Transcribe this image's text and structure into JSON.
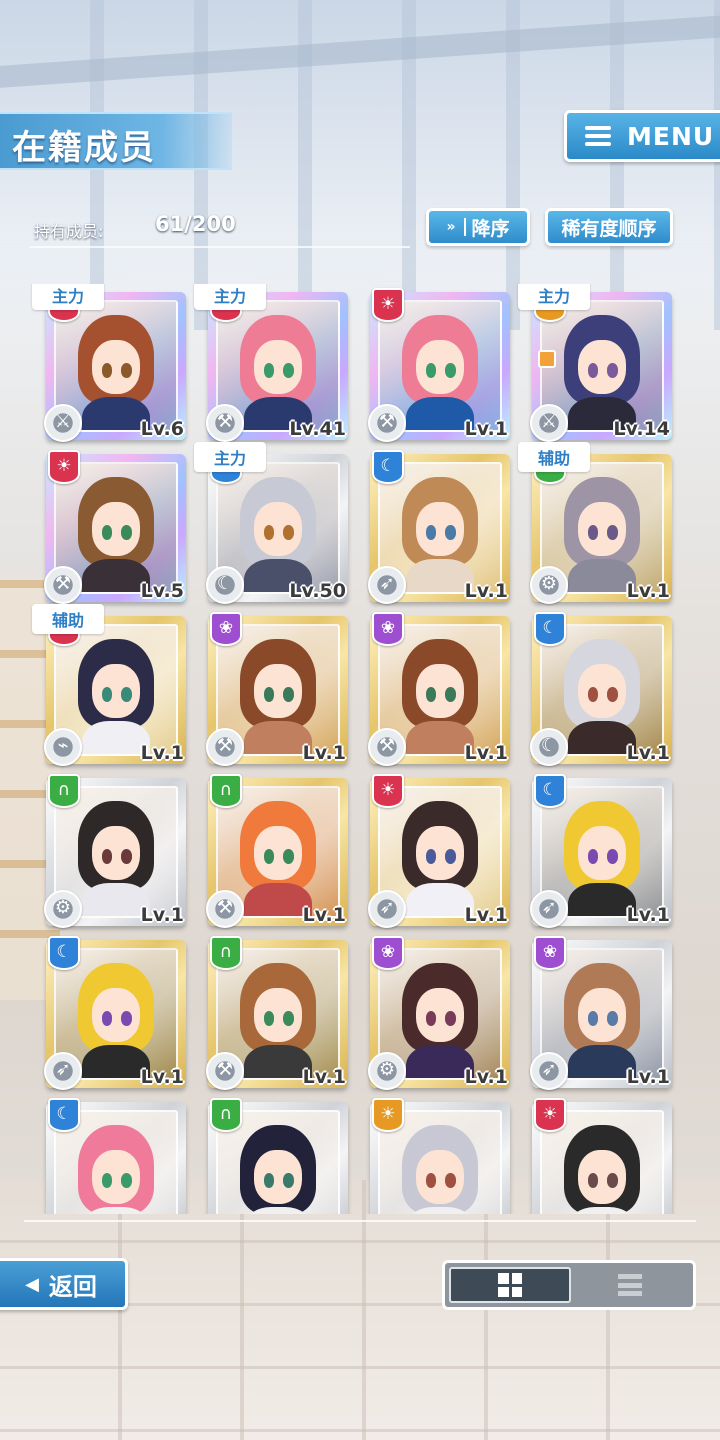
{
  "header": {
    "title": "在籍成员",
    "menu_label": "MENU"
  },
  "member_count": {
    "label": "持有成员:",
    "value": "61/200"
  },
  "sort": {
    "order_label": "降序",
    "order_icon": "chevron-double-down-icon",
    "rarity_label": "稀有度顺序"
  },
  "cards": [
    {
      "frame": "rainbow",
      "attribute": "red",
      "role": "主力",
      "level": "Lv.6",
      "type_icon": "sword-icon",
      "hair": "#a5502e",
      "outfit": "#2b3a6e",
      "eyes": "#8a5a2a"
    },
    {
      "frame": "rainbow",
      "attribute": "red",
      "role": "主力",
      "level": "Lv.41",
      "type_icon": "hammer-icon",
      "hair": "#ef7c95",
      "outfit": "#2b3a6e",
      "eyes": "#3a9a6a"
    },
    {
      "frame": "rainbow",
      "attribute": "red",
      "role": "",
      "level": "Lv.1",
      "type_icon": "hammer-icon",
      "hair": "#ef7c95",
      "outfit": "#1e5aa8",
      "eyes": "#3a9a6a"
    },
    {
      "frame": "rainbow",
      "attribute": "orange",
      "role": "主力",
      "level": "Lv.14",
      "type_icon": "sword-icon",
      "hair": "#3c3f7a",
      "outfit": "#2a2a3a",
      "eyes": "#7a5a9a",
      "locked": true
    },
    {
      "frame": "rainbow",
      "attribute": "red",
      "role": "",
      "level": "Lv.5",
      "type_icon": "hammer-icon",
      "hair": "#8a5a33",
      "outfit": "#3a3038",
      "eyes": "#3a8a5a"
    },
    {
      "frame": "silver",
      "attribute": "blue",
      "role": "主力",
      "level": "Lv.50",
      "type_icon": "scythe-icon",
      "hair": "#c7c9d4",
      "outfit": "#4a4f6a",
      "eyes": "#b07030"
    },
    {
      "frame": "gold",
      "attribute": "blue",
      "role": "",
      "level": "Lv.1",
      "type_icon": "spear-icon",
      "hair": "#c08a56",
      "outfit": "#e8d8c8",
      "eyes": "#4a7aa8"
    },
    {
      "frame": "gold",
      "attribute": "green",
      "role": "辅助",
      "level": "Lv.1",
      "type_icon": "shield-icon",
      "hair": "#9d94a6",
      "outfit": "#8a8a9a",
      "eyes": "#6a5a8a"
    },
    {
      "frame": "gold",
      "attribute": "red",
      "role": "辅助",
      "level": "Lv.1",
      "type_icon": "gun-icon",
      "hair": "#2c2c48",
      "outfit": "#f0f0f4",
      "eyes": "#3a8a7a"
    },
    {
      "frame": "gold",
      "attribute": "purple",
      "role": "",
      "level": "Lv.1",
      "type_icon": "hammer-icon",
      "hair": "#8a4a2a",
      "outfit": "#c08060",
      "eyes": "#3a7a5a"
    },
    {
      "frame": "gold",
      "attribute": "purple",
      "role": "",
      "level": "Lv.1",
      "type_icon": "hammer-icon",
      "hair": "#8a4a2a",
      "outfit": "#c08060",
      "eyes": "#3a7a5a"
    },
    {
      "frame": "gold",
      "attribute": "blue",
      "role": "",
      "level": "Lv.1",
      "type_icon": "scythe-icon",
      "hair": "#d6d6de",
      "outfit": "#3a2a2a",
      "eyes": "#a05040"
    },
    {
      "frame": "silver",
      "attribute": "green",
      "role": "",
      "level": "Lv.1",
      "type_icon": "shield-icon",
      "hair": "#2e2828",
      "outfit": "#e8e8ee",
      "eyes": "#6a3a3a"
    },
    {
      "frame": "gold",
      "attribute": "green",
      "role": "",
      "level": "Lv.1",
      "type_icon": "hammer-icon",
      "hair": "#f07a3c",
      "outfit": "#c04a4a",
      "eyes": "#3a8a5a"
    },
    {
      "frame": "gold",
      "attribute": "red",
      "role": "",
      "level": "Lv.1",
      "type_icon": "spear-icon",
      "hair": "#3a2a2a",
      "outfit": "#f0f0f6",
      "eyes": "#4a5a9a"
    },
    {
      "frame": "silver",
      "attribute": "blue",
      "role": "",
      "level": "Lv.1",
      "type_icon": "spear-icon",
      "hair": "#f0c832",
      "outfit": "#2a2a2a",
      "eyes": "#7a4ab0"
    },
    {
      "frame": "gold",
      "attribute": "blue",
      "role": "",
      "level": "Lv.1",
      "type_icon": "spear-icon",
      "hair": "#f0c832",
      "outfit": "#2a2a2a",
      "eyes": "#7a4ab0"
    },
    {
      "frame": "gold",
      "attribute": "green",
      "role": "",
      "level": "Lv.1",
      "type_icon": "hammer-icon",
      "hair": "#a8683a",
      "outfit": "#3a3a3a",
      "eyes": "#3a8a5a"
    },
    {
      "frame": "gold",
      "attribute": "purple",
      "role": "",
      "level": "Lv.1",
      "type_icon": "shield-icon",
      "hair": "#4a2a2a",
      "outfit": "#3a2a5a",
      "eyes": "#7a3a5a"
    },
    {
      "frame": "silver",
      "attribute": "purple",
      "role": "",
      "level": "Lv.1",
      "type_icon": "spear-icon",
      "hair": "#b07a56",
      "outfit": "#2a3a5a",
      "eyes": "#5a7aa8"
    },
    {
      "frame": "silver",
      "attribute": "blue",
      "role": "",
      "level": "",
      "type_icon": "",
      "hair": "#f07a9a",
      "outfit": "#f0f0f0",
      "eyes": "#3a9a6a"
    },
    {
      "frame": "silver",
      "attribute": "green",
      "role": "",
      "level": "",
      "type_icon": "",
      "hair": "#22223a",
      "outfit": "#f0f0f0",
      "eyes": "#3a7a6a"
    },
    {
      "frame": "silver",
      "attribute": "orange",
      "role": "",
      "level": "",
      "type_icon": "",
      "hair": "#c8c8d4",
      "outfit": "#f0f0f0",
      "eyes": "#a05040"
    },
    {
      "frame": "silver",
      "attribute": "red",
      "role": "",
      "level": "",
      "type_icon": "",
      "hair": "#2a2a2a",
      "outfit": "#f0f0f0",
      "eyes": "#6a4a4a"
    }
  ],
  "footer": {
    "back_label": "返回",
    "view_grid_icon": "grid-view-icon",
    "view_list_icon": "list-view-icon",
    "active_view": "grid"
  },
  "colors": {
    "primary_blue": "#2e8ccb",
    "attr_red": "#d9334f",
    "attr_blue": "#2e82d8",
    "attr_green": "#3aae44",
    "attr_purple": "#9e4ed0",
    "attr_orange": "#e69a23"
  }
}
